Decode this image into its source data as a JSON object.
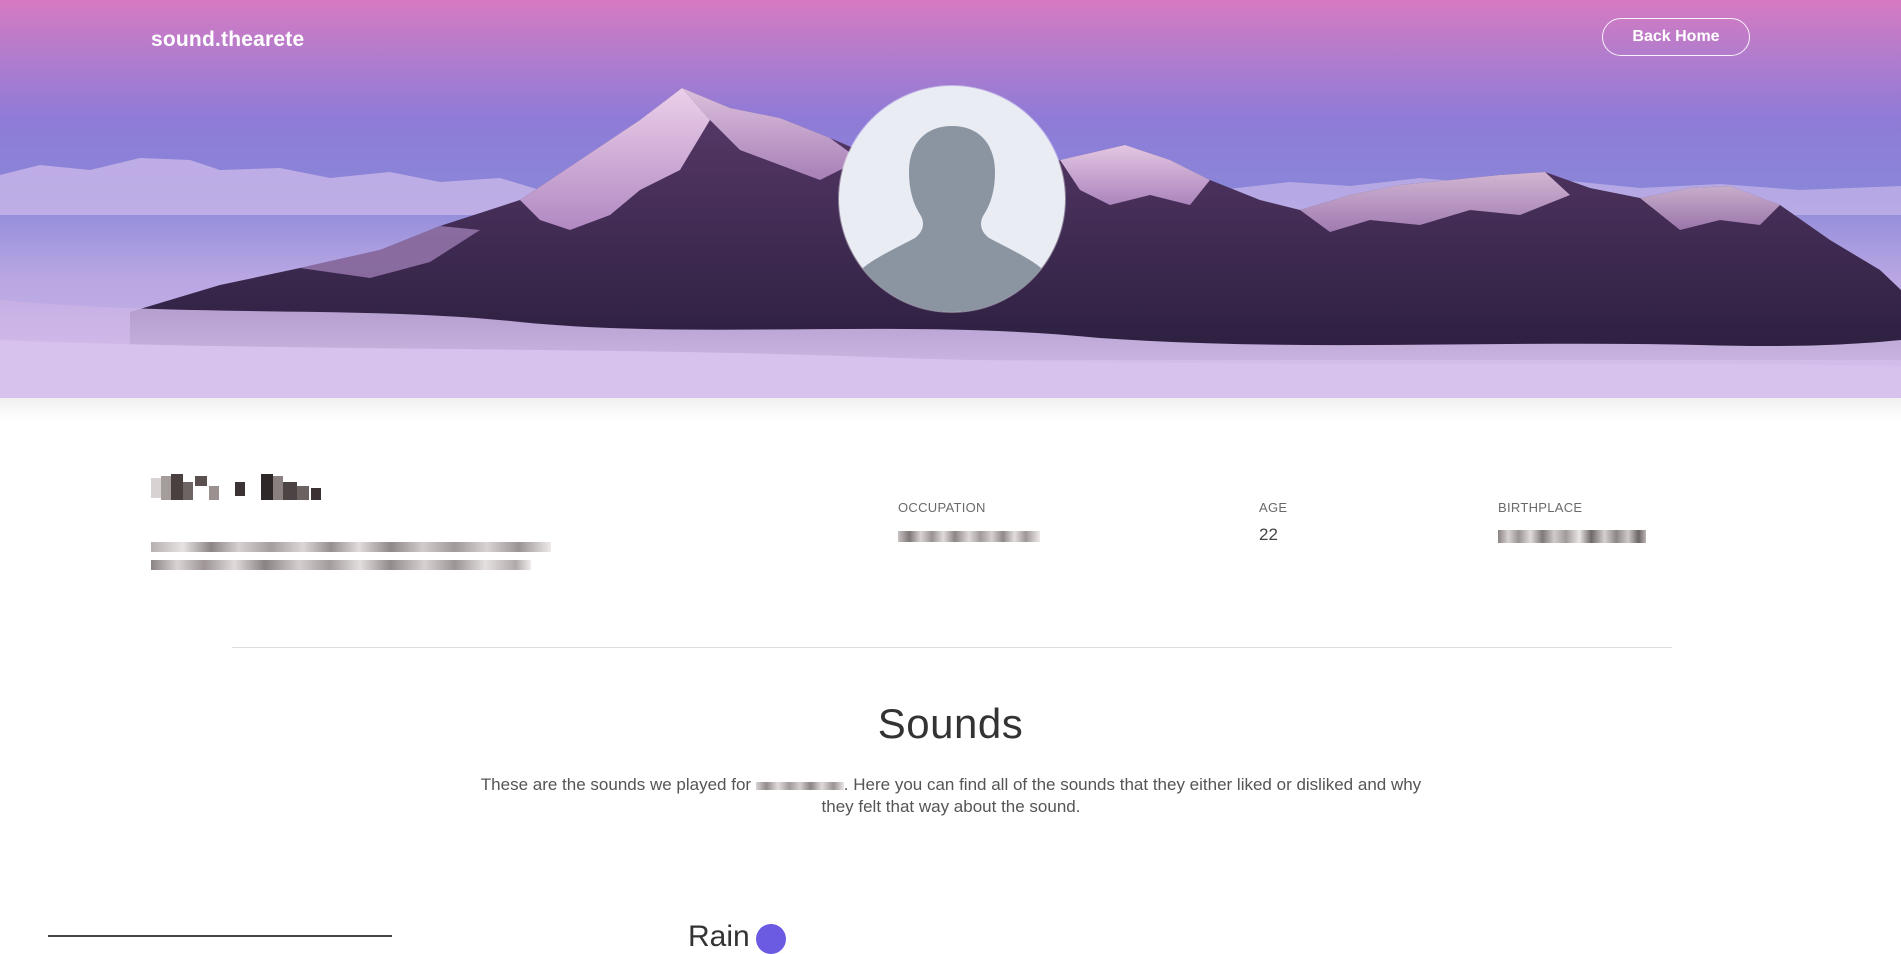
{
  "header": {
    "brand": "sound.thearete",
    "back_label": "Back Home"
  },
  "hero": {
    "avatar_icon": "user-silhouette-icon"
  },
  "profile": {
    "stats": [
      {
        "label": "OCCUPATION",
        "value": ""
      },
      {
        "label": "AGE",
        "value": "22"
      },
      {
        "label": "BIRTHPLACE",
        "value": ""
      }
    ]
  },
  "sounds": {
    "title": "Sounds",
    "desc_before": "These are the sounds we played for ",
    "desc_after": ". Here you can find all of the sounds that they either liked or disliked and why they felt that way about the sound.",
    "first_item": "Rain"
  },
  "colors": {
    "accent": "#6a5be2",
    "text": "#333333"
  }
}
